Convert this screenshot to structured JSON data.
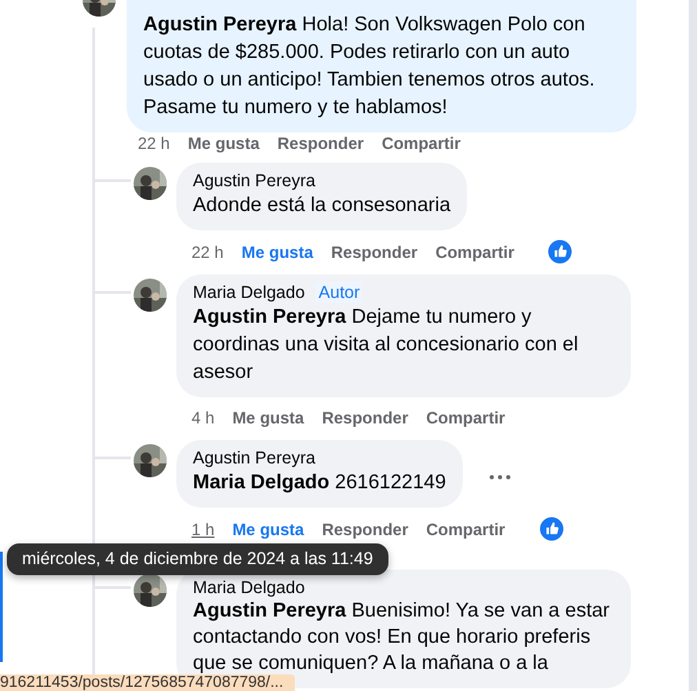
{
  "comments": [
    {
      "highlighted": true,
      "mention": "Agustin Pereyra",
      "text": "Hola! Son Volkswagen Polo con cuotas de $285.000. Podes retirarlo con un auto usado o un anticipo! Tambien tenemos otros autos. Pasame tu numero y te hablamos!",
      "time": "22 h",
      "time_hovered": false,
      "like_label": "Me gusta",
      "liked": false,
      "reply_label": "Responder",
      "share_label": "Compartir",
      "reaction": false,
      "more_menu": false,
      "children": [
        {
          "highlighted": false,
          "author": "Agustin Pereyra",
          "text": "Adonde está la consesonaria",
          "time": "22 h",
          "time_hovered": false,
          "like_label": "Me gusta",
          "liked": true,
          "reply_label": "Responder",
          "share_label": "Compartir",
          "reaction": true,
          "more_menu": false
        },
        {
          "highlighted": false,
          "author": "Maria Delgado",
          "badge": "Autor",
          "mention": "Agustin Pereyra",
          "text": "Dejame tu numero y coordinas una visita al concesionario con el asesor",
          "time": "4 h",
          "time_hovered": false,
          "like_label": "Me gusta",
          "liked": false,
          "reply_label": "Responder",
          "share_label": "Compartir",
          "reaction": false,
          "more_menu": false
        },
        {
          "highlighted": false,
          "author": "Agustin Pereyra",
          "mention": "Maria Delgado",
          "text": "2616122149",
          "time": "1 h",
          "time_hovered": true,
          "like_label": "Me gusta",
          "liked": true,
          "reply_label": "Responder",
          "share_label": "Compartir",
          "reaction": true,
          "more_menu": true
        },
        {
          "highlighted": false,
          "author": "Maria Delgado",
          "mention": "Agustin Pereyra",
          "text": "Buenisimo! Ya se van a estar contactando con vos! En que horario preferis que se comuniquen? A la mañana o a la"
        }
      ]
    }
  ],
  "tooltip": "miércoles, 4 de diciembre de 2024 a las 11:49",
  "status_url": "916211453/posts/1275685747087798/..."
}
